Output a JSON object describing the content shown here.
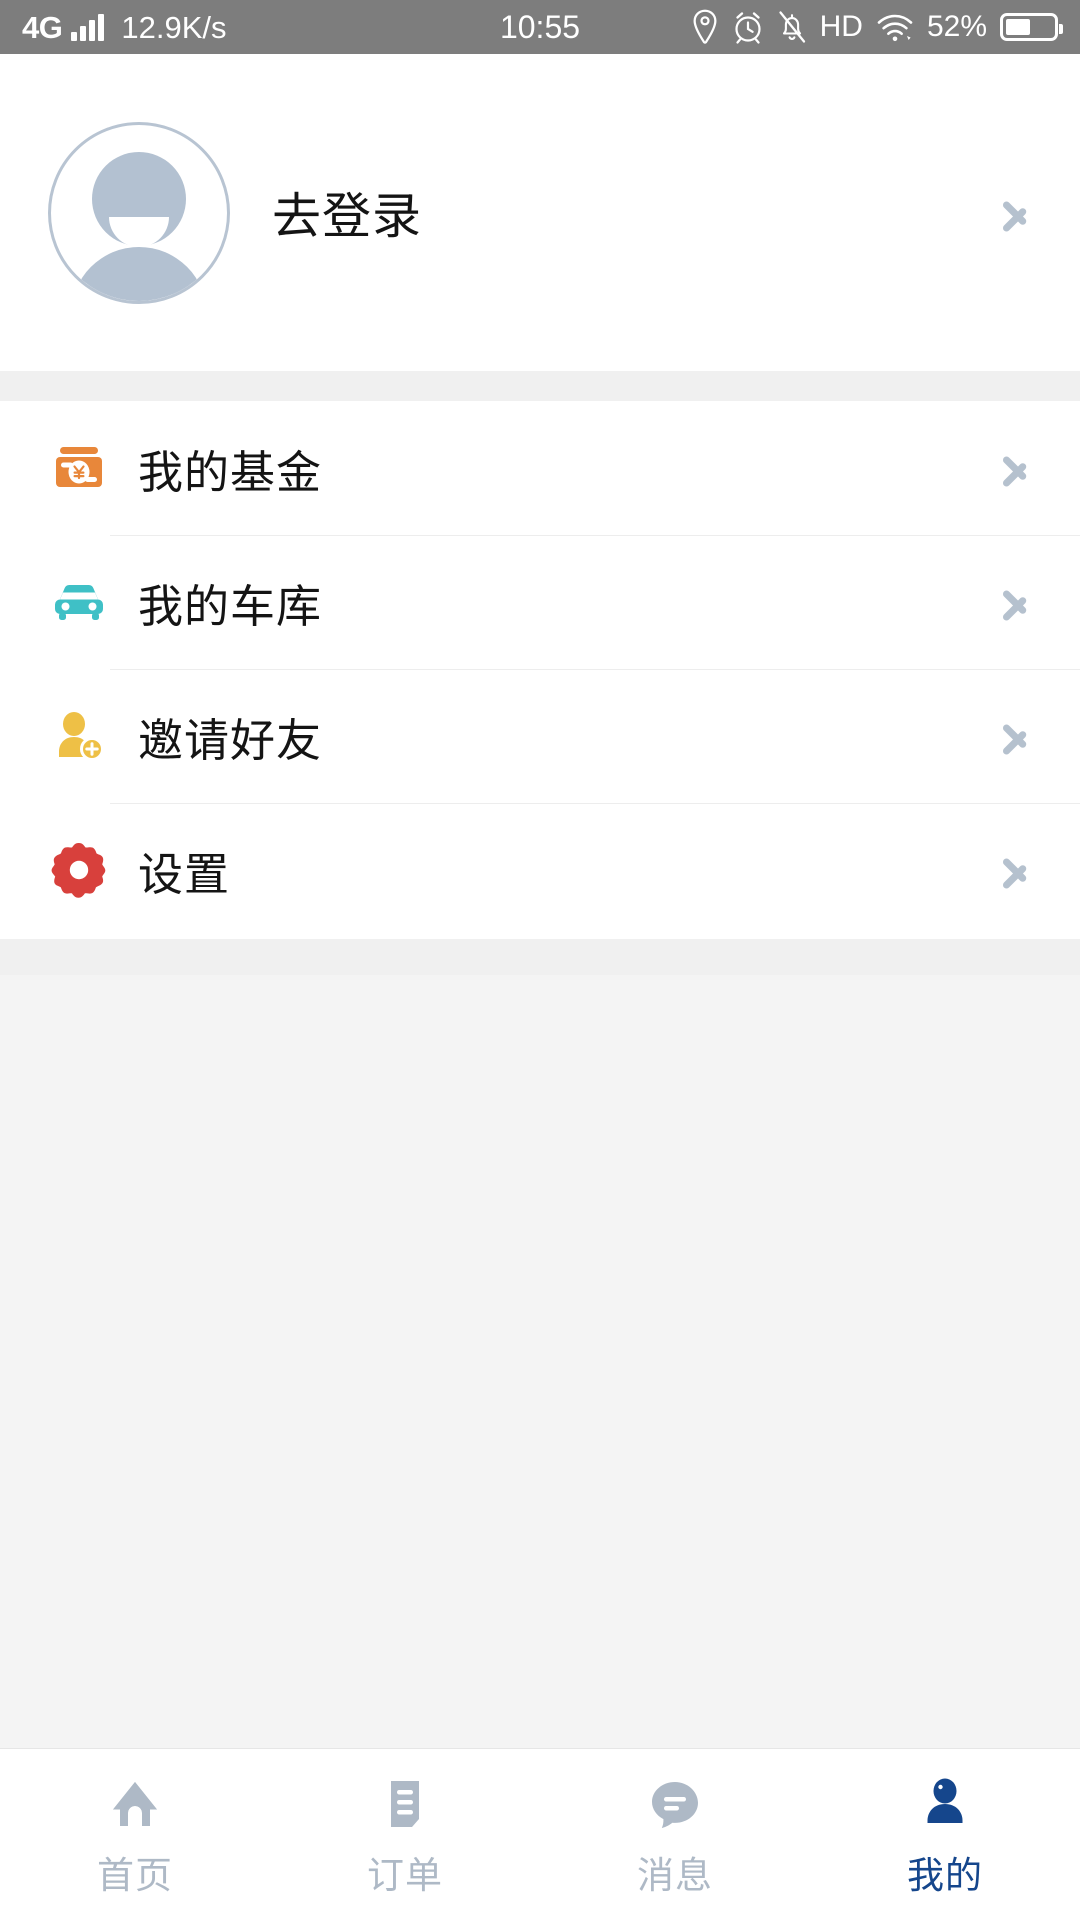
{
  "statusbar": {
    "network_type": "4G",
    "signal_icon": "signal-bars-icon",
    "net_speed": "12.9K/s",
    "time": "10:55",
    "icons": [
      "location-pin-icon",
      "alarm-clock-icon",
      "bell-muted-icon",
      "wifi-icon"
    ],
    "hd_label": "HD",
    "battery_percent": "52%",
    "battery_level": 52
  },
  "profile": {
    "avatar_icon": "default-avatar-icon",
    "login_label": "去登录",
    "chevron_icon": "chevron-right-icon"
  },
  "menu": {
    "items": [
      {
        "label": "我的基金",
        "icon": "fund-wallet-icon",
        "icon_color": "#e8873a",
        "chevron_icon": "chevron-right-icon"
      },
      {
        "label": "我的车库",
        "icon": "car-icon",
        "icon_color": "#3fc0c6",
        "chevron_icon": "chevron-right-icon"
      },
      {
        "label": "邀请好友",
        "icon": "invite-friend-icon",
        "icon_color": "#eec046",
        "chevron_icon": "chevron-right-icon"
      },
      {
        "label": "设置",
        "icon": "gear-icon",
        "icon_color": "#d8403c",
        "chevron_icon": "chevron-right-icon"
      }
    ]
  },
  "tabbar": {
    "items": [
      {
        "label": "首页",
        "icon": "home-icon",
        "active": false
      },
      {
        "label": "订单",
        "icon": "orders-icon",
        "active": false
      },
      {
        "label": "消息",
        "icon": "message-icon",
        "active": false
      },
      {
        "label": "我的",
        "icon": "person-icon",
        "active": true
      }
    ],
    "active_color": "#15468c",
    "inactive_color": "#aeb9c6"
  },
  "colors": {
    "statusbar_bg": "#7d7d7d",
    "page_bg": "#f4f4f4",
    "card_bg": "#ffffff",
    "band": "#f0f0f0",
    "divider": "#ededed",
    "chevron": "#b5c1ce",
    "avatar": "#b3c1d1",
    "text": "#141414"
  }
}
